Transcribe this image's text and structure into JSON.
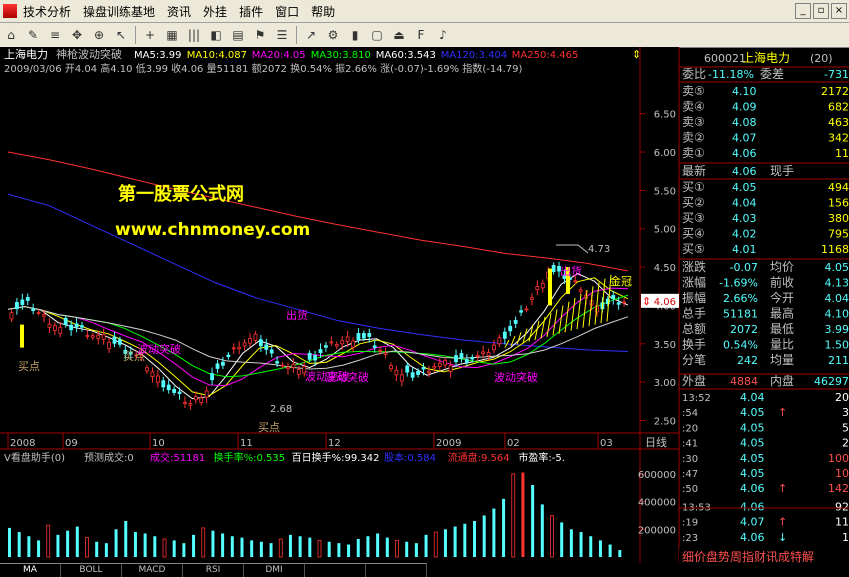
{
  "menu": [
    "技术分析",
    "操盘训练基地",
    "资讯",
    "外挂",
    "插件",
    "窗口",
    "帮助"
  ],
  "toolbar_icons": [
    "home-icon",
    "pencil-icon",
    "lines-icon",
    "pan-icon",
    "zoom-icon",
    "arrow-icon",
    "cross-icon",
    "grid-icon",
    "bars-icon",
    "bookmark-icon",
    "chart-icon",
    "flag-icon",
    "list-icon",
    "trend-icon",
    "gear-icon",
    "candle-icon",
    "window-icon",
    "exit-icon",
    "f10-icon",
    "sound-icon"
  ],
  "chart_header": {
    "stock": "上海电力",
    "indicator": "神枪波动突破",
    "ma": [
      {
        "label": "MA5:",
        "value": "3.99",
        "color": "#ffffff"
      },
      {
        "label": "MA10:",
        "value": "4.087",
        "color": "#ffff00"
      },
      {
        "label": "MA20:",
        "value": "4.05",
        "color": "#ff00ff"
      },
      {
        "label": "MA30:",
        "value": "3.810",
        "color": "#00ff00"
      },
      {
        "label": "MA60:",
        "value": "3.543",
        "color": "#ffffff"
      },
      {
        "label": "MA120:",
        "value": "3.404",
        "color": "#3030ff"
      },
      {
        "label": "MA250:",
        "value": "4.465",
        "color": "#ff3030"
      }
    ]
  },
  "quote_line": "2009/03/06 开4.04 高4.10 低3.99 收4.06 量51181 额2072 换0.54% 振2.66% 涨(-0.07)-1.69% 指数(-14.79)",
  "watermark": {
    "line1": "第一股票公式网",
    "line2": "www.chnmoney.com"
  },
  "price_axis": [
    "6.50",
    "6.00",
    "5.50",
    "5.00",
    "4.50",
    "4.00",
    "3.50",
    "3.00",
    "2.50"
  ],
  "current_price_tag": "4.06",
  "date_axis": [
    "2008",
    "09",
    "10",
    "11",
    "12",
    "2009",
    "02",
    "03"
  ],
  "date_label": "日线",
  "annotations": {
    "high": "4.73",
    "low": "2.68",
    "gold": "金冠",
    "buy": [
      "买点",
      "买点",
      "买点"
    ],
    "sell": [
      "出货",
      "出货"
    ],
    "breakout": [
      "波动突破",
      "波动突破",
      "波动突破",
      "波动突破"
    ]
  },
  "vol_header": {
    "name": "V看盘助手(0)",
    "predict": "预测成交:0",
    "items": [
      {
        "label": "成交:",
        "value": "51181",
        "color": "#ff00ff"
      },
      {
        "label": "换手率%:",
        "value": "0.535",
        "color": "#00ff00"
      },
      {
        "label": "百日换手%:",
        "value": "99.342",
        "color": "#ffffff"
      },
      {
        "label": "股本:",
        "value": "0.584",
        "color": "#3030ff"
      },
      {
        "label": "流通盘:",
        "value": "9.564",
        "color": "#ff3030"
      },
      {
        "label": "市盈率:",
        "value": "-5.",
        "color": "#ffffff"
      }
    ]
  },
  "vol_axis": [
    "600000",
    "400000",
    "200000"
  ],
  "tabs": [
    "MA",
    "BOLL",
    "MACD",
    "RSI",
    "DMI",
    "",
    ""
  ],
  "quote_panel": {
    "code": "600021",
    "name": "上海电力",
    "count": "(20)",
    "weibi_label": "委比",
    "weibi": "-11.18%",
    "weicha_label": "委差",
    "weicha": "-731",
    "sells": [
      {
        "label": "卖⑤",
        "price": "4.10",
        "vol": "2172"
      },
      {
        "label": "卖④",
        "price": "4.09",
        "vol": "682"
      },
      {
        "label": "卖③",
        "price": "4.08",
        "vol": "463"
      },
      {
        "label": "卖②",
        "price": "4.07",
        "vol": "342"
      },
      {
        "label": "卖①",
        "price": "4.06",
        "vol": "11"
      }
    ],
    "latest_label": "最新",
    "latest": "4.06",
    "xianshou_label": "现手",
    "xianshou": "",
    "buys": [
      {
        "label": "买①",
        "price": "4.05",
        "vol": "494"
      },
      {
        "label": "买②",
        "price": "4.04",
        "vol": "156"
      },
      {
        "label": "买③",
        "price": "4.03",
        "vol": "380"
      },
      {
        "label": "买④",
        "price": "4.02",
        "vol": "795"
      },
      {
        "label": "买⑤",
        "price": "4.01",
        "vol": "1168"
      }
    ],
    "stats": [
      {
        "l1": "涨跌",
        "v1": "-0.07",
        "l2": "均价",
        "v2": "4.05"
      },
      {
        "l1": "涨幅",
        "v1": "-1.69%",
        "l2": "前收",
        "v2": "4.13"
      },
      {
        "l1": "振幅",
        "v1": "2.66%",
        "l2": "今开",
        "v2": "4.04"
      },
      {
        "l1": "总手",
        "v1": "51181",
        "l2": "最高",
        "v2": "4.10"
      },
      {
        "l1": "总额",
        "v1": "2072",
        "l2": "最低",
        "v2": "3.99"
      },
      {
        "l1": "换手",
        "v1": "0.54%",
        "l2": "量比",
        "v2": "1.50"
      },
      {
        "l1": "分笔",
        "v1": "242",
        "l2": "均量",
        "v2": "211"
      }
    ],
    "waipan_label": "外盘",
    "waipan": "4884",
    "neipan_label": "内盘",
    "neipan": "46297",
    "ticks": [
      {
        "t": "13:52",
        "p": "4.04",
        "arrow": "",
        "v": "20",
        "vc": "#ffffff"
      },
      {
        "t": ":54",
        "p": "4.05",
        "arrow": "↑",
        "v": "3",
        "vc": "#ffffff"
      },
      {
        "t": ":20",
        "p": "4.05",
        "arrow": "",
        "v": "5",
        "vc": "#ffffff"
      },
      {
        "t": ":41",
        "p": "4.05",
        "arrow": "",
        "v": "2",
        "vc": "#ffffff"
      },
      {
        "t": ":30",
        "p": "4.05",
        "arrow": "",
        "v": "100",
        "vc": "#ff5050"
      },
      {
        "t": ":47",
        "p": "4.05",
        "arrow": "",
        "v": "10",
        "vc": "#ff5050"
      },
      {
        "t": ":50",
        "p": "4.06",
        "arrow": "↑",
        "v": "142",
        "vc": "#ff5050"
      },
      {
        "t": "13:53",
        "p": "4.06",
        "arrow": "",
        "v": "92",
        "vc": "#ffffff"
      },
      {
        "t": ":19",
        "p": "4.07",
        "arrow": "↑",
        "v": "11",
        "vc": "#ffffff"
      },
      {
        "t": ":23",
        "p": "4.06",
        "arrow": "↓",
        "v": "1",
        "vc": "#ffffff"
      }
    ],
    "bottom_tabs": "细价盘势周指财讯成特解"
  },
  "chart_data": {
    "type": "candlestick",
    "ylim": [
      2.35,
      6.9
    ],
    "x_categories": [
      "2008",
      "09",
      "10",
      "11",
      "12",
      "2009",
      "02",
      "03"
    ],
    "close_approx": [
      3.95,
      4.02,
      3.85,
      3.7,
      3.72,
      3.62,
      3.55,
      3.42,
      3.3,
      3.05,
      2.85,
      2.72,
      2.9,
      3.25,
      3.5,
      3.58,
      3.35,
      3.18,
      3.2,
      3.4,
      3.52,
      3.58,
      3.55,
      3.35,
      3.08,
      3.1,
      3.22,
      3.25,
      3.3,
      3.35,
      3.55,
      3.75,
      4.1,
      4.45,
      4.38,
      4.25,
      3.95,
      4.06
    ],
    "ma250": [
      6.0,
      5.9,
      5.78,
      5.65,
      5.52,
      5.4,
      5.28,
      5.16,
      5.05,
      4.95,
      4.85,
      4.77,
      4.68,
      4.62,
      4.55,
      4.45
    ],
    "ma120": [
      5.45,
      5.3,
      5.05,
      4.8,
      4.55,
      4.3,
      4.1,
      3.95,
      3.8,
      3.7,
      3.62,
      3.55,
      3.5,
      3.46,
      3.42,
      3.4
    ],
    "high": "4.73",
    "low": "2.68",
    "last": "4.06"
  },
  "volume_data": {
    "ylim": [
      0,
      650000
    ],
    "values": [
      210000,
      180000,
      150000,
      120000,
      230000,
      160000,
      190000,
      220000,
      140000,
      110000,
      100000,
      200000,
      260000,
      180000,
      170000,
      150000,
      130000,
      120000,
      100000,
      160000,
      210000,
      190000,
      170000,
      150000,
      140000,
      120000,
      110000,
      100000,
      130000,
      160000,
      150000,
      140000,
      120000,
      110000,
      100000,
      90000,
      130000,
      150000,
      170000,
      140000,
      120000,
      110000,
      100000,
      160000,
      180000,
      200000,
      220000,
      240000,
      260000,
      300000,
      350000,
      420000,
      600000,
      610000,
      520000,
      380000,
      300000,
      250000,
      200000,
      180000,
      150000,
      120000,
      90000,
      50000
    ]
  }
}
